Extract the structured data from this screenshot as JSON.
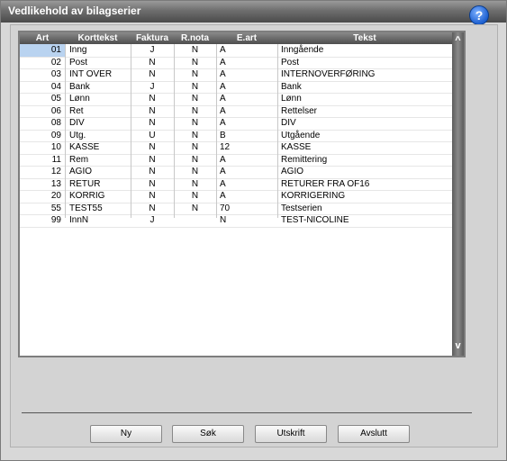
{
  "window": {
    "title": "Vedlikehold av bilagserier",
    "help_label": "?"
  },
  "table": {
    "columns": [
      "Art",
      "Korttekst",
      "Faktura",
      "R.nota",
      "E.art",
      "Tekst"
    ],
    "rows": [
      [
        "01",
        "Inng",
        "J",
        "N",
        "A",
        "Inngående"
      ],
      [
        "02",
        "Post",
        "N",
        "N",
        "A",
        "Post"
      ],
      [
        "03",
        "INT OVER",
        "N",
        "N",
        "A",
        "INTERNOVERFØRING"
      ],
      [
        "04",
        "Bank",
        "J",
        "N",
        "A",
        "Bank"
      ],
      [
        "05",
        "Lønn",
        "N",
        "N",
        "A",
        "Lønn"
      ],
      [
        "06",
        "Ret",
        "N",
        "N",
        "A",
        "Rettelser"
      ],
      [
        "08",
        "DIV",
        "N",
        "N",
        "A",
        "DIV"
      ],
      [
        "09",
        "Utg.",
        "U",
        "N",
        "B",
        "Utgående"
      ],
      [
        "10",
        "KASSE",
        "N",
        "N",
        "12",
        "KASSE"
      ],
      [
        "11",
        "Rem",
        "N",
        "N",
        "A",
        "Remittering"
      ],
      [
        "12",
        "AGIO",
        "N",
        "N",
        "A",
        "AGIO"
      ],
      [
        "13",
        "RETUR",
        "N",
        "N",
        "A",
        "RETURER FRA OF16"
      ],
      [
        "20",
        "KORRIG",
        "N",
        "N",
        "A",
        "KORRIGERING"
      ],
      [
        "55",
        "TEST55",
        "N",
        "N",
        "70",
        "Testserien"
      ],
      [
        "99",
        "InnN",
        "J",
        "",
        "N",
        "TEST-NICOLINE"
      ]
    ],
    "selected_row": 0
  },
  "scroll": {
    "up_label": "^",
    "down_label": "v"
  },
  "buttons": {
    "new": "Ny",
    "search": "Søk",
    "print": "Utskrift",
    "close": "Avslutt"
  }
}
